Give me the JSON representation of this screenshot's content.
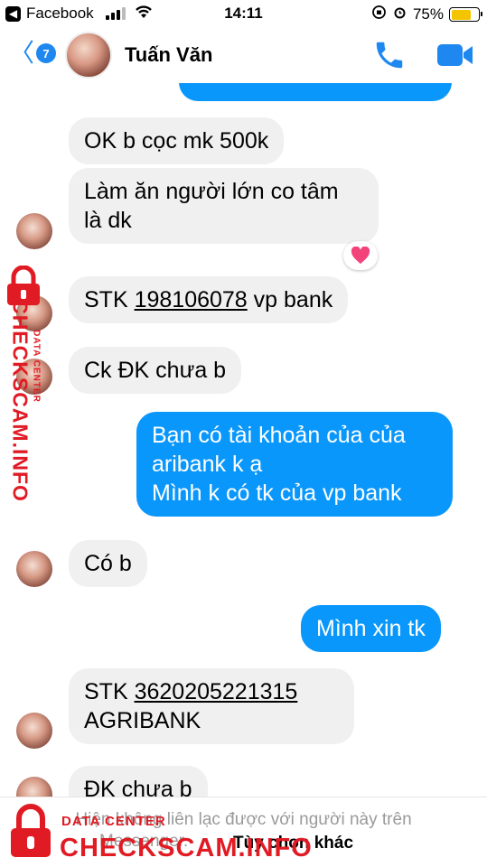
{
  "status_bar": {
    "app_back": "Facebook",
    "time": "14:11",
    "battery": "75%",
    "battery_level": 0.75
  },
  "header": {
    "unread_count": "7",
    "contact_name": "Tuấn Văn"
  },
  "messages": [
    {
      "text": "OK b cọc mk 500k"
    },
    {
      "line1": "Làm ăn người lớn co tâm",
      "line2": "là dk",
      "reaction": "heart"
    },
    {
      "prefix": "STK ",
      "account": "198106078",
      "suffix": " vp bank"
    },
    {
      "text": "Ck ĐK chưa b"
    },
    {
      "line1": "Bạn có tài khoản của của",
      "line2": "aribank k ạ",
      "line3": "Mình k có tk của vp bank"
    },
    {
      "text": "Có b"
    },
    {
      "text": "Mình xin tk"
    },
    {
      "prefix": "STK ",
      "account": "3620205221315",
      "line2": "AGRIBANK"
    },
    {
      "text": "ĐK chưa b"
    }
  ],
  "footer": {
    "notice_line1": "Hiện không liên lạc được với người này trên",
    "notice_line2": "Messenger.",
    "options": "Tùy chọn khác"
  },
  "watermark": {
    "small": "DATA CENTER",
    "big": "CHECKSCAM.INFO"
  },
  "colors": {
    "accent": "#0a97fb",
    "incoming_bubble": "#f0f0f0",
    "watermark": "#e01b24"
  }
}
